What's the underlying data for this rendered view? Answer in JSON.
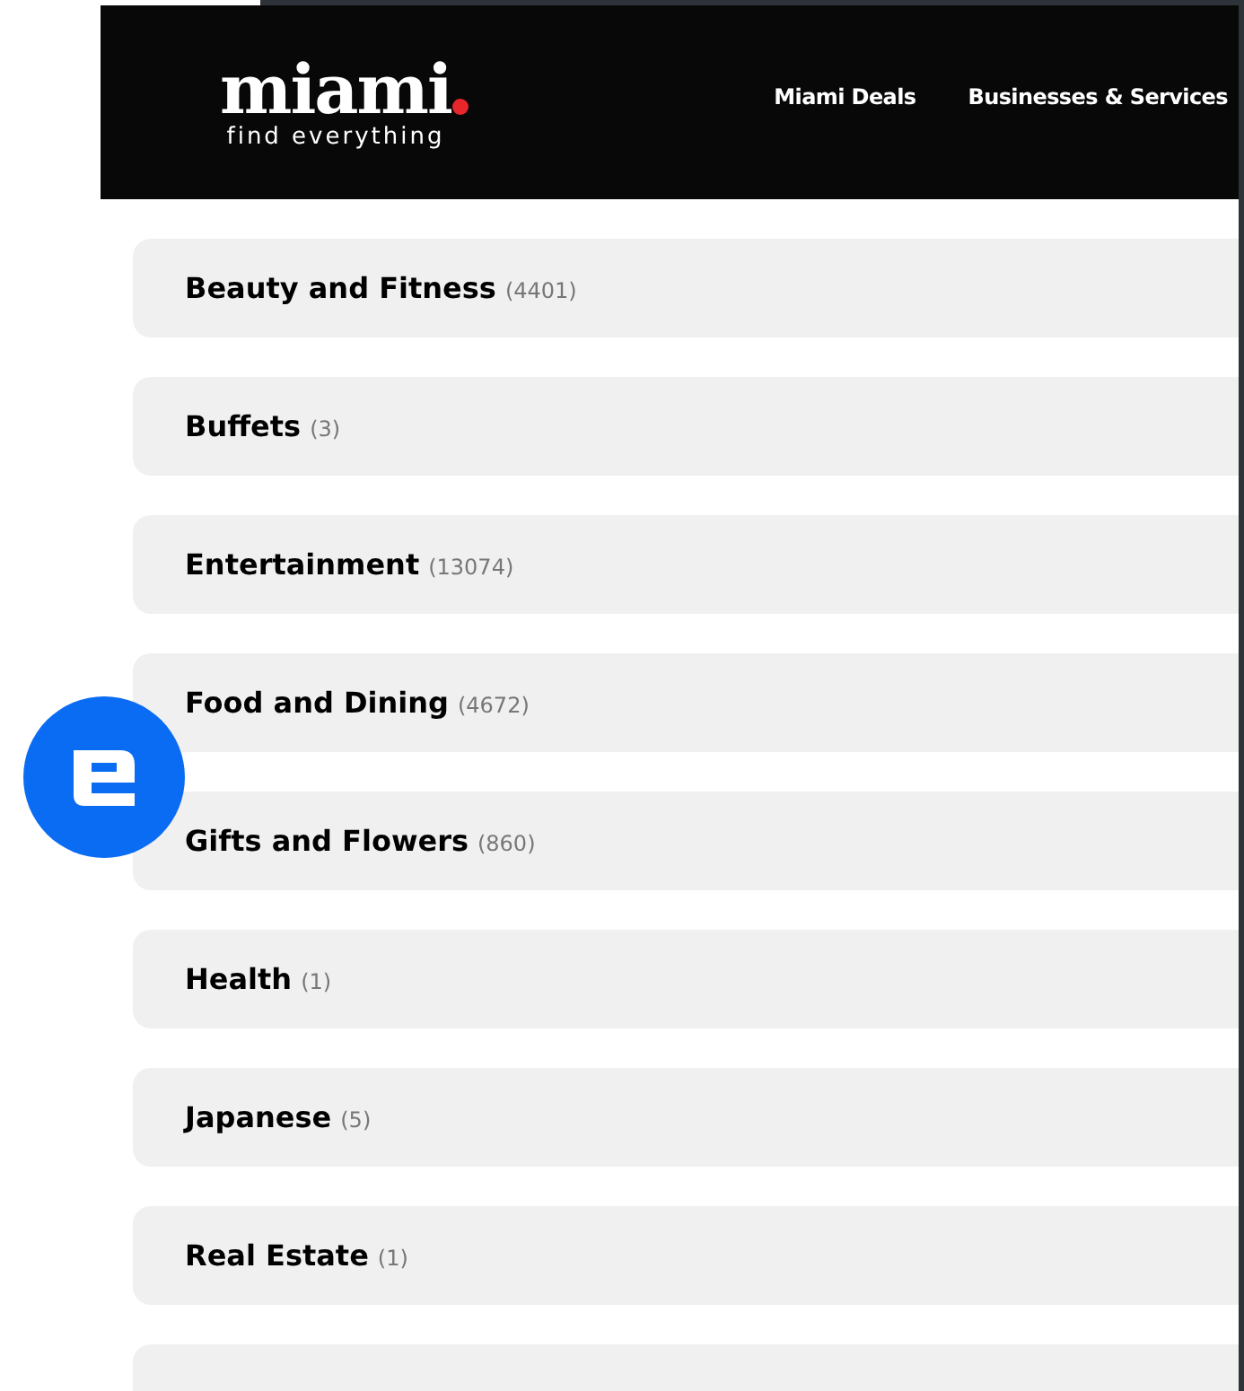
{
  "header": {
    "logo": {
      "wordmark": "miami",
      "tagline": "find everything"
    },
    "nav": [
      {
        "label": "Miami Deals"
      },
      {
        "label": "Businesses & Services"
      }
    ]
  },
  "categories": [
    {
      "name": "Beauty and Fitness",
      "count": "(4401)"
    },
    {
      "name": "Buffets",
      "count": "(3)"
    },
    {
      "name": "Entertainment",
      "count": "(13074)"
    },
    {
      "name": "Food and Dining",
      "count": "(4672)"
    },
    {
      "name": "Gifts and Flowers",
      "count": "(860)"
    },
    {
      "name": "Health",
      "count": "(1)"
    },
    {
      "name": "Japanese",
      "count": "(5)"
    },
    {
      "name": "Real Estate",
      "count": "(1)"
    }
  ]
}
